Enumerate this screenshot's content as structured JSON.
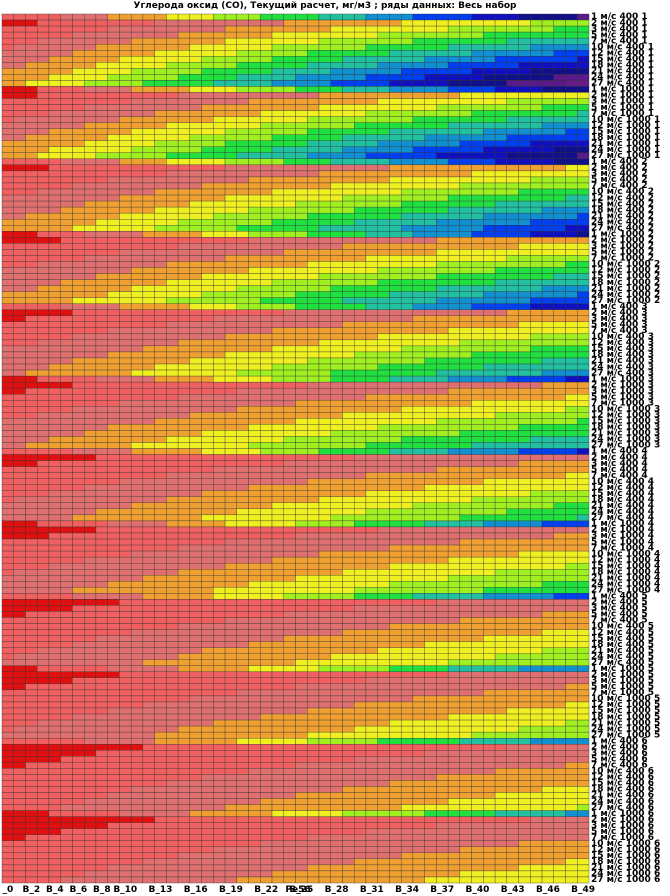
{
  "chart_data": {
    "type": "heatmap",
    "title": "Углерода оксид (CO), Текущий расчет,  мг/м3  ; ряды данных: Весь набор",
    "xlabel": "",
    "ylabel": "",
    "x_tick_labels": [
      "_0",
      "B_2",
      "B_4",
      "B_6",
      "B_8",
      "B_10",
      "B_13",
      "B_16",
      "B_19",
      "B_22",
      "B_25",
      "B_28",
      "B_31",
      "B_34",
      "B_37",
      "B_40",
      "B_43",
      "B_46",
      "B_49"
    ],
    "x_axis_marker": "Pe56",
    "stability_classes": [
      "1",
      "2",
      "3",
      "4",
      "5",
      "6"
    ],
    "distances": [
      "400",
      "1000"
    ],
    "wind_speeds": [
      "1",
      "2",
      "3",
      "5",
      "7",
      "10",
      "12",
      "15",
      "18",
      "21",
      "24",
      "27"
    ],
    "rows_per_block": 12,
    "block_order": [
      "400 1",
      "1000 1",
      "400 2",
      "1000 2",
      "400 3",
      "1000 3",
      "400 4",
      "1000 4",
      "400 5",
      "1000 5",
      "400 6",
      "1000 6"
    ],
    "columns": 50,
    "color_scale": [
      "#e01010",
      "#f06060",
      "#e07070",
      "#f0a030",
      "#f0f020",
      "#a0f020",
      "#20e040",
      "#20c0a0",
      "#1090d0",
      "#0040f0",
      "#1010c0",
      "#10108a",
      "#5a1a8a",
      "#6a1a8a",
      "#6a1a6a"
    ],
    "colors": {
      "grid_line": "#303030",
      "text": "#000000",
      "background": "#ffffff"
    }
  }
}
